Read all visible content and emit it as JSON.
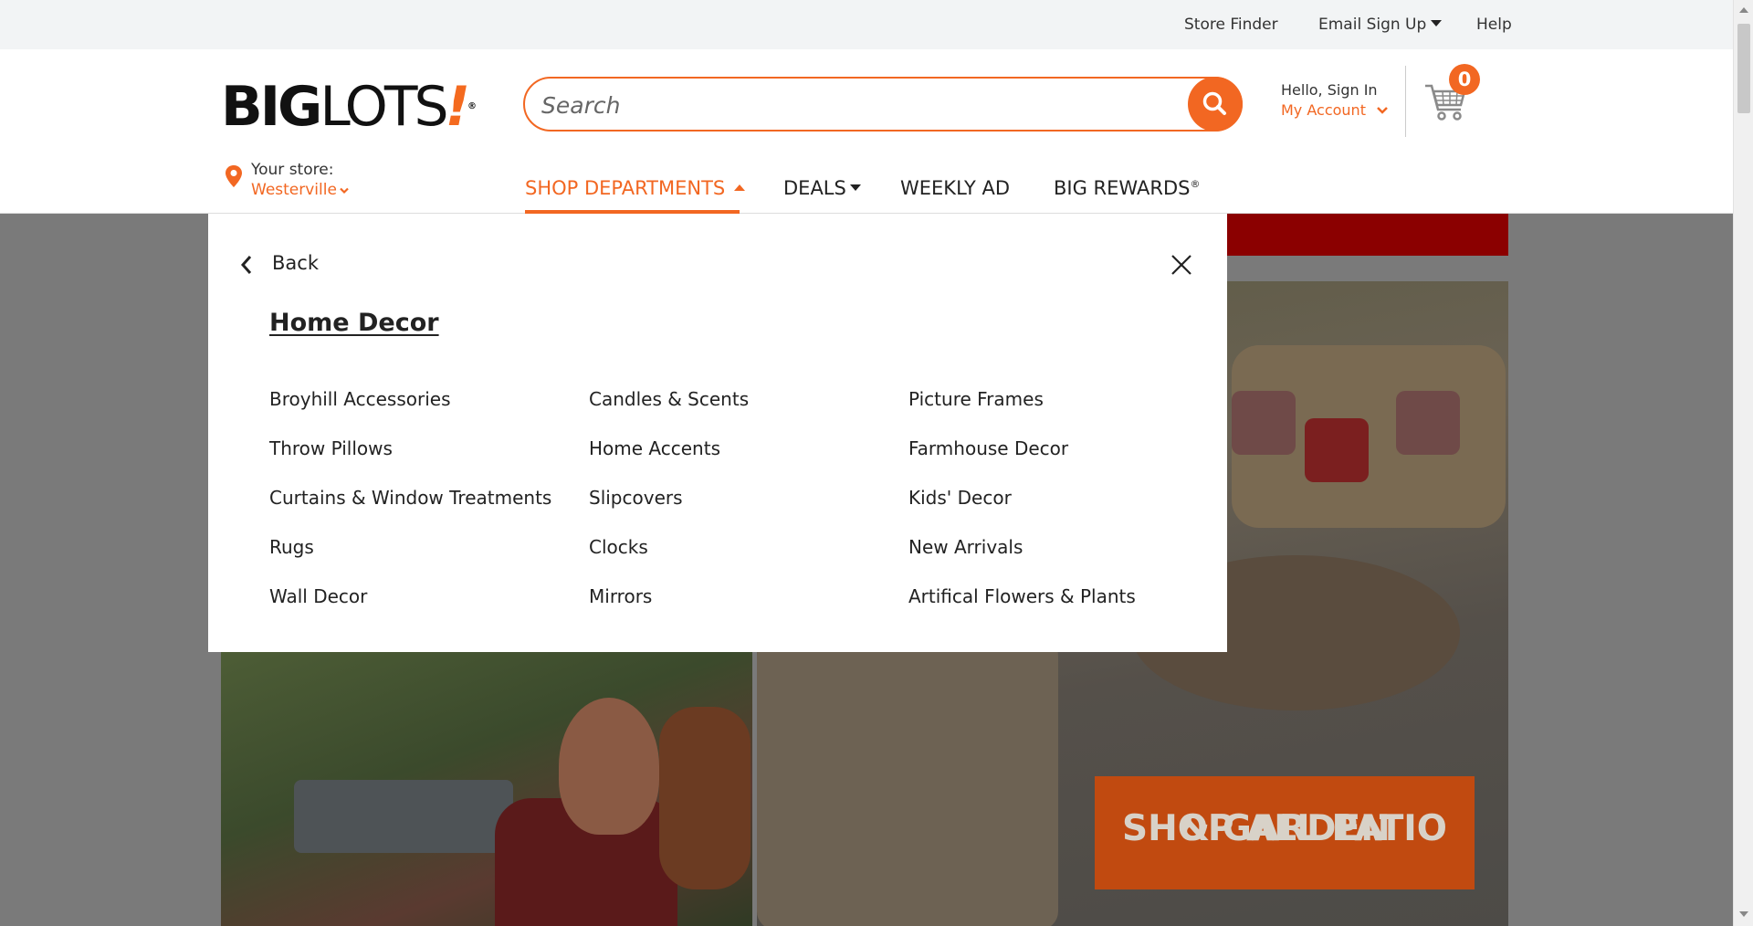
{
  "utility": {
    "store_finder": "Store Finder",
    "email_signup": "Email Sign Up",
    "help": "Help"
  },
  "header": {
    "logo_big": "BIG",
    "logo_lots": "LOTS",
    "logo_bang": "!",
    "logo_reg": "®",
    "search_placeholder": "Search",
    "hello": "Hello, Sign In",
    "my_account": "My Account",
    "cart_count": "0",
    "store_label": "Your store:",
    "store_name": "Westerville"
  },
  "nav": {
    "shop_departments": "SHOP DEPARTMENTS",
    "deals": "DEALS",
    "weekly_ad": "WEEKLY AD",
    "big_rewards": "BIG REWARDS",
    "big_rewards_mark": "®"
  },
  "mega_menu": {
    "back": "Back",
    "title": "Home Decor",
    "columns": [
      [
        "Broyhill Accessories",
        "Throw Pillows",
        "Curtains & Window Treatments",
        "Rugs",
        "Wall Decor"
      ],
      [
        "Candles & Scents",
        "Home Accents",
        "Slipcovers",
        "Clocks",
        "Mirrors"
      ],
      [
        "Picture Frames",
        "Farmhouse Decor",
        "Kids' Decor",
        "New Arrivals",
        "Artifical Flowers & Plants"
      ]
    ]
  },
  "promo": {
    "cta_line1": "SHOP ALL PATIO",
    "cta_line2": "& GARDEN"
  },
  "colors": {
    "accent": "#f26722",
    "overlay_gray": "#7a7a7a",
    "banner_red": "#8b0000"
  }
}
